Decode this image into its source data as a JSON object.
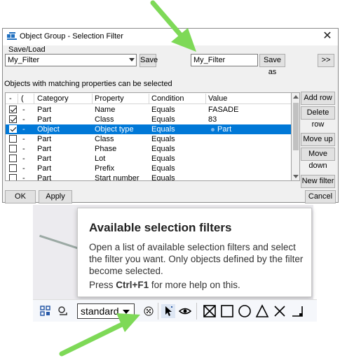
{
  "dialog": {
    "title": "Object Group - Selection Filter",
    "save_load_label": "Save/Load",
    "preset_value": "My_Filter",
    "save_button": "Save",
    "save_as_value": "My_Filter",
    "save_as_button": "Save as",
    "expand_button": ">>",
    "matching_label": "Objects with matching properties can be selected",
    "columns": [
      "-",
      "(",
      "Category",
      "Property",
      "Condition",
      "Value"
    ],
    "rows": [
      {
        "checked": true,
        "dash": "-",
        "category": "Part",
        "property": "Name",
        "condition": "Equals",
        "value": "FASADE",
        "selected": false
      },
      {
        "checked": true,
        "dash": "-",
        "category": "Part",
        "property": "Class",
        "condition": "Equals",
        "value": "83",
        "selected": false
      },
      {
        "checked": true,
        "dash": "-",
        "category": "Object",
        "property": "Object type",
        "condition": "Equals",
        "value": "Part",
        "selected": true
      },
      {
        "checked": false,
        "dash": "-",
        "category": "Part",
        "property": "Class",
        "condition": "Equals",
        "value": "",
        "selected": false
      },
      {
        "checked": false,
        "dash": "-",
        "category": "Part",
        "property": "Phase",
        "condition": "Equals",
        "value": "",
        "selected": false
      },
      {
        "checked": false,
        "dash": "-",
        "category": "Part",
        "property": "Lot",
        "condition": "Equals",
        "value": "",
        "selected": false
      },
      {
        "checked": false,
        "dash": "-",
        "category": "Part",
        "property": "Prefix",
        "condition": "Equals",
        "value": "",
        "selected": false
      },
      {
        "checked": false,
        "dash": "-",
        "category": "Part",
        "property": "Start number",
        "condition": "Equals",
        "value": "",
        "selected": false
      }
    ],
    "side_buttons": [
      "Add row",
      "Delete row",
      "Move up",
      "Move down",
      "New filter"
    ],
    "ok_button": "OK",
    "apply_button": "Apply",
    "cancel_button": "Cancel"
  },
  "tooltip": {
    "title": "Available selection filters",
    "body": "Open a list of available selection filters and select the filter you want. Only objects defined by the filter become selected.",
    "help_prefix": "Press ",
    "help_key": "Ctrl+F1",
    "help_suffix": " for more help on this."
  },
  "toolbar": {
    "dropdown_value": "standard"
  },
  "colors": {
    "selection": "#0078d7",
    "arrow": "#7ed957"
  }
}
